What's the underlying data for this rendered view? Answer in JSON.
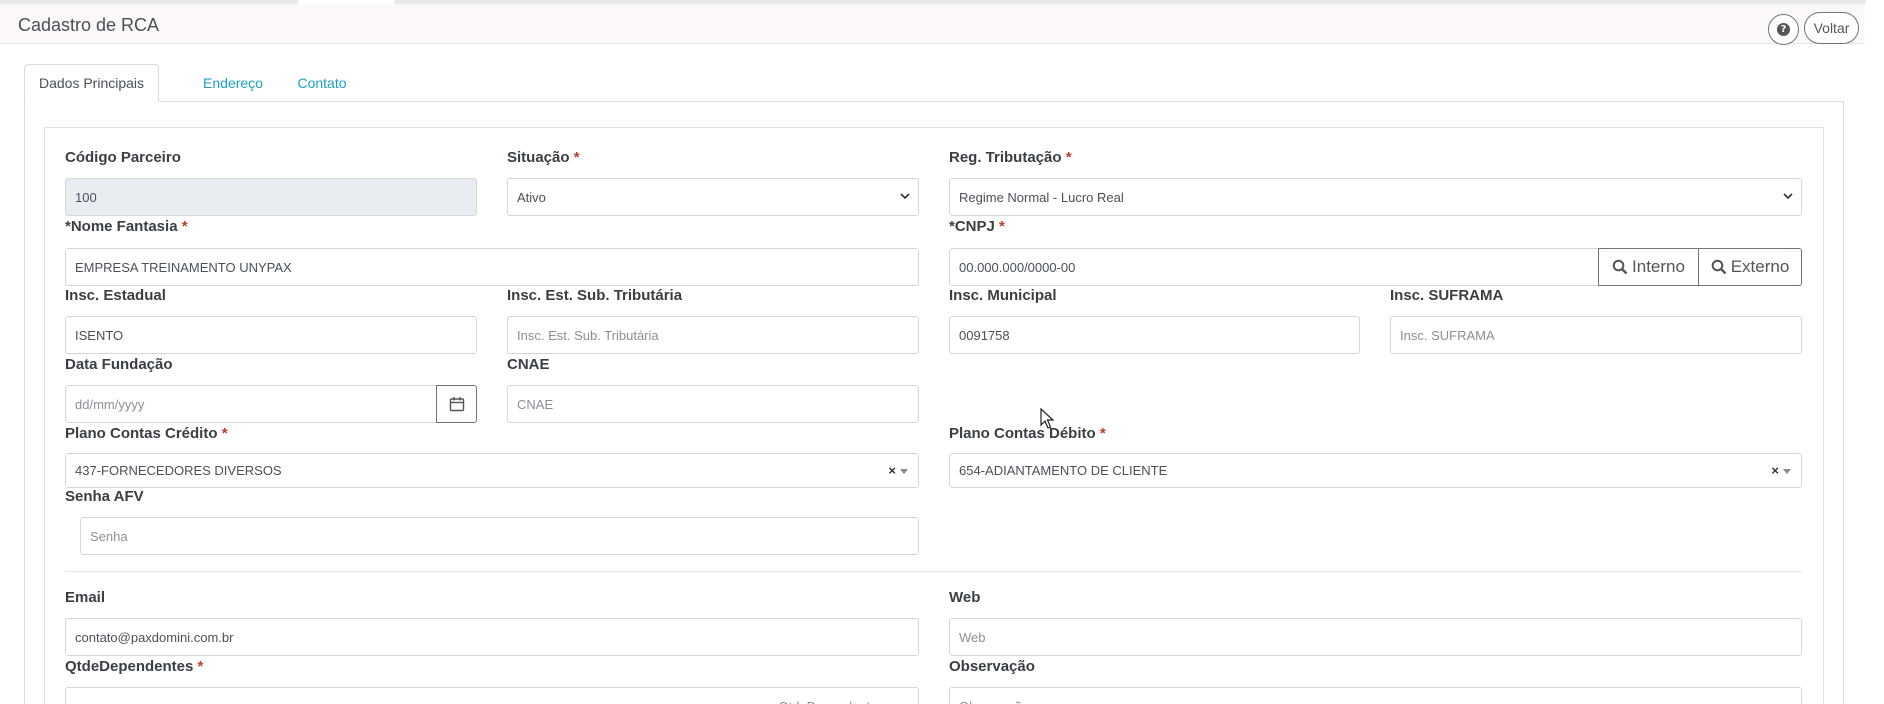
{
  "header": {
    "title": "Cadastro de RCA",
    "help_icon": "question-circle-icon",
    "back_label": "Voltar"
  },
  "tabs": [
    {
      "label": "Dados Principais",
      "active": true
    },
    {
      "label": "Endereço",
      "active": false
    },
    {
      "label": "Contato",
      "active": false
    }
  ],
  "form": {
    "codigo_parceiro": {
      "label": "Código Parceiro",
      "value": "100"
    },
    "situacao": {
      "label": "Situação",
      "required": "*",
      "value": "Ativo"
    },
    "reg_tributacao": {
      "label": "Reg. Tributação",
      "required": "*",
      "value": "Regime Normal - Lucro Real"
    },
    "nome_fantasia": {
      "label": "*Nome Fantasia",
      "required": "*",
      "value": "EMPRESA TREINAMENTO UNYPAX"
    },
    "cnpj": {
      "label": "*CNPJ",
      "required": "*",
      "value": "00.000.000/0000-00",
      "btn_interno": "Interno",
      "btn_externo": "Externo"
    },
    "insc_estadual": {
      "label": "Insc. Estadual",
      "value": "ISENTO"
    },
    "insc_est_sub": {
      "label": "Insc. Est. Sub. Tributária",
      "placeholder": "Insc. Est. Sub. Tributária"
    },
    "insc_municipal": {
      "label": "Insc. Municipal",
      "value": "0091758"
    },
    "insc_suframa": {
      "label": "Insc. SUFRAMA",
      "placeholder": "Insc. SUFRAMA"
    },
    "data_fundacao": {
      "label": "Data Fundação",
      "placeholder": "dd/mm/yyyy"
    },
    "cnae": {
      "label": "CNAE",
      "placeholder": "CNAE"
    },
    "plano_credito": {
      "label": "Plano Contas Crédito",
      "required": "*",
      "value": "437-FORNECEDORES DIVERSOS",
      "clear": "×"
    },
    "plano_debito": {
      "label": "Plano Contas Débito",
      "required": "*",
      "value": "654-ADIANTAMENTO DE CLIENTE",
      "clear": "×"
    },
    "senha_afv": {
      "label": "Senha AFV",
      "placeholder": "Senha"
    },
    "email": {
      "label": "Email",
      "value": "contato@paxdomini.com.br"
    },
    "web": {
      "label": "Web",
      "placeholder": "Web"
    },
    "qtde_dependentes": {
      "label": "QtdeDependentes",
      "required": "*",
      "placeholder": "QtdeDependentes"
    },
    "observacao": {
      "label": "Observação",
      "placeholder": "Observação"
    }
  }
}
